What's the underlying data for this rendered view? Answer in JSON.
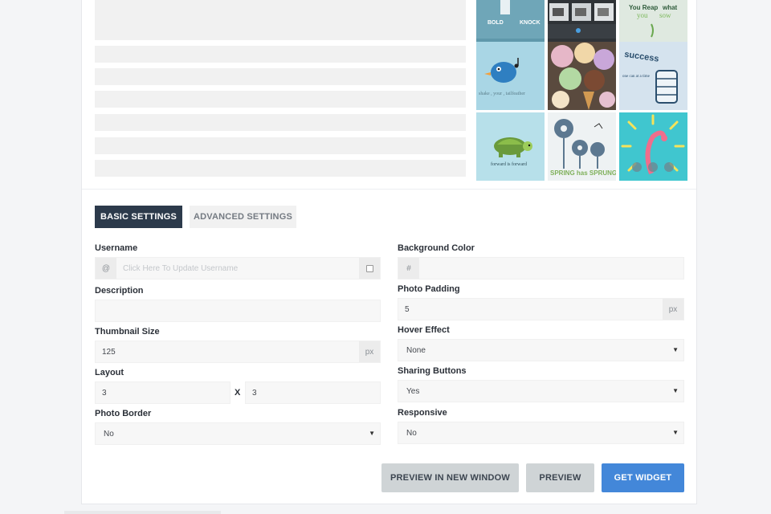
{
  "gallery": {
    "tile1_text": [
      "BOLD",
      "KNOCK"
    ],
    "tile3_text": [
      "You Reap",
      "what",
      "you",
      "sow"
    ],
    "tile4_text": "shake , your , tailfeather",
    "tile6_text": [
      "success",
      "one can at a time"
    ],
    "tile7_text": "forward is forward",
    "tile8_text": "SPRING has SPRUNG"
  },
  "tabs": {
    "basic": "BASIC SETTINGS",
    "advanced": "ADVANCED SETTINGS"
  },
  "left": {
    "username_label": "Username",
    "username_prefix": "@",
    "username_placeholder": "Click Here To Update Username",
    "description_label": "Description",
    "description_value": "",
    "thumb_label": "Thumbnail Size",
    "thumb_value": "125",
    "thumb_unit": "px",
    "layout_label": "Layout",
    "layout_cols": "3",
    "layout_sep": "X",
    "layout_rows": "3",
    "border_label": "Photo Border",
    "border_value": "No"
  },
  "right": {
    "bg_label": "Background Color",
    "bg_prefix": "#",
    "bg_value": "",
    "padding_label": "Photo Padding",
    "padding_value": "5",
    "padding_unit": "px",
    "hover_label": "Hover Effect",
    "hover_value": "None",
    "sharing_label": "Sharing Buttons",
    "sharing_value": "Yes",
    "responsive_label": "Responsive",
    "responsive_value": "No"
  },
  "buttons": {
    "preview_new": "PREVIEW IN NEW WINDOW",
    "preview": "PREVIEW",
    "get_widget": "GET WIDGET"
  },
  "colors": {
    "tab_active": "#2c3a4b",
    "primary": "#4387d9",
    "secondary": "#cfd4d6"
  }
}
